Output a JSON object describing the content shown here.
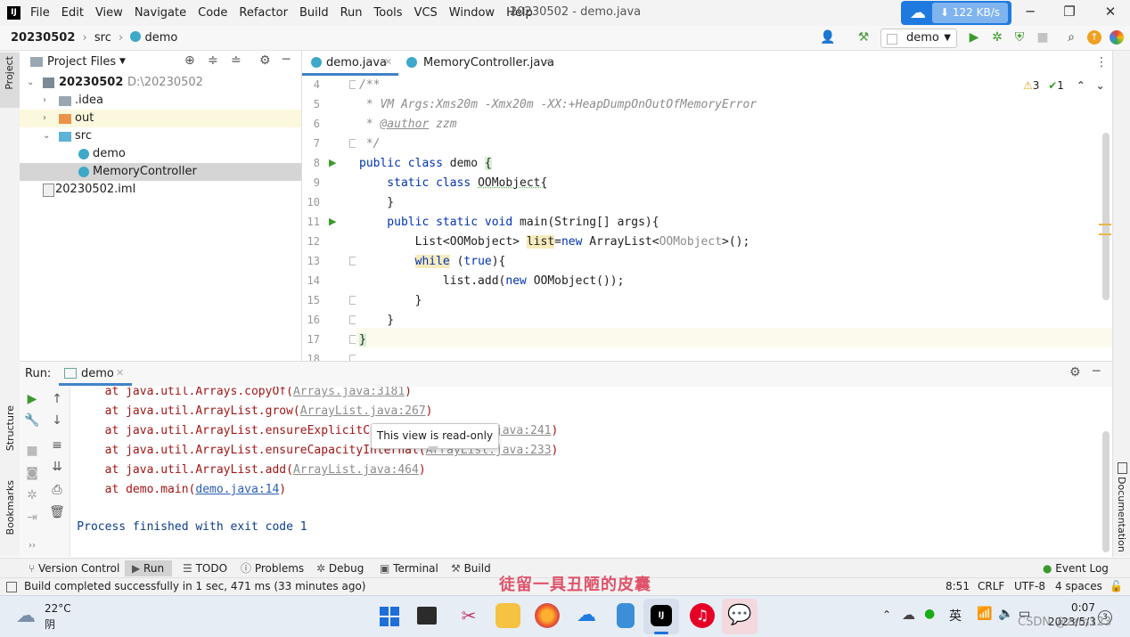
{
  "window": {
    "menu": [
      "File",
      "Edit",
      "View",
      "Navigate",
      "Code",
      "Refactor",
      "Build",
      "Run",
      "Tools",
      "VCS",
      "Window",
      "Help"
    ],
    "title": "20230502 - demo.java",
    "net_speed": "122 KB/s",
    "controls": {
      "minimize": "─",
      "maximize": "❐",
      "close": "✕"
    }
  },
  "nav": {
    "breadcrumbs": [
      "20230502",
      "src",
      "demo"
    ],
    "run_config": "demo"
  },
  "sidebar": {
    "project_tab": "Project",
    "structure_tab": "Structure",
    "bookmarks_tab": "Bookmarks"
  },
  "project": {
    "header": "Project Files",
    "tree": [
      {
        "label": "20230502",
        "extra": "D:\\20230502",
        "type": "module",
        "expanded": true
      },
      {
        "label": ".idea",
        "type": "folder",
        "expanded": false
      },
      {
        "label": "out",
        "type": "folder-orange",
        "expanded": false
      },
      {
        "label": "src",
        "type": "folder-src",
        "expanded": true
      },
      {
        "label": "demo",
        "type": "class"
      },
      {
        "label": "MemoryController",
        "type": "class",
        "selected": true
      },
      {
        "label": "20230502.iml",
        "type": "file"
      }
    ]
  },
  "editor": {
    "tabs": [
      {
        "label": "demo.java",
        "active": true
      },
      {
        "label": "MemoryController.java",
        "active": false
      }
    ],
    "inspections": {
      "warnings": "3",
      "ok": "1"
    },
    "line_numbers": [
      "4",
      "5",
      "6",
      "7",
      "8",
      "9",
      "10",
      "11",
      "12",
      "13",
      "14",
      "15",
      "16",
      "17",
      "18"
    ],
    "code": {
      "l4": "/**",
      "l5": " * VM Args:Xms20m -Xmx20m -XX:+HeapDumpOnOutOfMemoryError",
      "l6a": " * ",
      "l6b": "@author",
      "l6c": " zzm",
      "l7": " */",
      "l8a": "public class ",
      "l8b": "demo ",
      "l8c": "{",
      "l9a": "    static class ",
      "l9b": "OOMobject{",
      "l10": "    }",
      "l11a": "    public static void ",
      "l11b": "main(String[] args){",
      "l12a": "        List<OOMobject> ",
      "l12b": "list",
      "l12c": "=",
      "l12d": "new ",
      "l12e": "ArrayList<",
      "l12f": "OOMobject",
      "l12g": ">();",
      "l13a": "        ",
      "l13b": "while",
      "l13c": " (",
      "l13d": "true",
      "l13e": "){",
      "l14a": "            list.add(",
      "l14b": "new ",
      "l14c": "OOMobject());",
      "l15": "        }",
      "l16": "    }",
      "l17": "}"
    }
  },
  "run": {
    "label": "Run:",
    "tab": "demo",
    "console": [
      {
        "pre": "        at java.util.Arrays.copyOf(",
        "link": "Arrays.java:3181",
        "post": ")"
      },
      {
        "pre": "        at java.util.ArrayList.grow(",
        "link": "ArrayList.java:267",
        "post": ")"
      },
      {
        "pre": "        at java.util.ArrayList.ensureExplicitCapacity(",
        "link": "ArrayList.java:241",
        "post": ")"
      },
      {
        "pre": "        at java.util.ArrayList.ensureCapacityInternal(",
        "link": "ArrayList.java:233",
        "post": ")"
      },
      {
        "pre": "        at java.util.ArrayList.add(",
        "link": "ArrayList.java:464",
        "post": ")"
      },
      {
        "pre": "        at demo.main(",
        "link": "demo.java:14",
        "post": ")"
      }
    ],
    "finish": "    Process finished with exit code 1",
    "tooltip": "This view is read-only"
  },
  "right_strip": {
    "documentation": "Documentation"
  },
  "tool_windows": [
    "Version Control",
    "Run",
    "TODO",
    "Problems",
    "Debug",
    "Terminal",
    "Build"
  ],
  "event_log": "Event Log",
  "status": {
    "message": "Build completed successfully in 1 sec, 471 ms (33 minutes ago)",
    "watermark": "徒留一具丑陋的皮囊",
    "position": "8:51",
    "line_sep": "CRLF",
    "encoding": "UTF-8",
    "indent": "4 spaces"
  },
  "taskbar": {
    "temp": "22°C",
    "weather": "阴",
    "ime": "英",
    "time": "0:07",
    "date": "2023/5/3",
    "notif": "3",
    "csdn": "CSDN @zzm123"
  },
  "colors": {
    "accent": "#2675bf",
    "keyword": "#0033b3",
    "comment": "#8c8c8c",
    "error": "#a31515",
    "selection": "#d5d5d5",
    "watermark": "#e0526a"
  }
}
